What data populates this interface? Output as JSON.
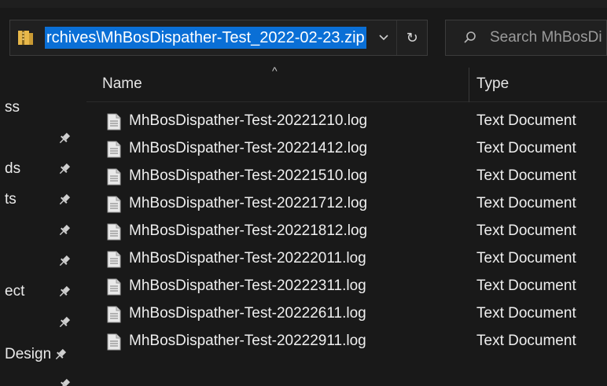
{
  "address": {
    "path": "rchives\\MhBosDispather-Test_2022-02-23.zip",
    "chevron_glyph": "⌄",
    "refresh_glyph": "↻"
  },
  "search": {
    "placeholder": "Search MhBosDi"
  },
  "nav": {
    "items": [
      {
        "label": "ss",
        "pinned": false
      },
      {
        "label": "",
        "pinned": true
      },
      {
        "label": "ds",
        "pinned": true
      },
      {
        "label": "ts",
        "pinned": true
      },
      {
        "label": "",
        "pinned": true
      },
      {
        "label": "",
        "pinned": true
      },
      {
        "label": "ect",
        "pinned": true
      },
      {
        "label": "",
        "pinned": true
      },
      {
        "label": "Design",
        "pinned": true
      },
      {
        "label": "",
        "pinned": true
      }
    ]
  },
  "columns": {
    "name": "Name",
    "type": "Type",
    "sort_glyph": "^"
  },
  "files": [
    {
      "name": "MhBosDispather-Test-20221210.log",
      "type": "Text Document"
    },
    {
      "name": "MhBosDispather-Test-20221412.log",
      "type": "Text Document"
    },
    {
      "name": "MhBosDispather-Test-20221510.log",
      "type": "Text Document"
    },
    {
      "name": "MhBosDispather-Test-20221712.log",
      "type": "Text Document"
    },
    {
      "name": "MhBosDispather-Test-20221812.log",
      "type": "Text Document"
    },
    {
      "name": "MhBosDispather-Test-20222011.log",
      "type": "Text Document"
    },
    {
      "name": "MhBosDispather-Test-20222311.log",
      "type": "Text Document"
    },
    {
      "name": "MhBosDispather-Test-20222611.log",
      "type": "Text Document"
    },
    {
      "name": "MhBosDispather-Test-20222911.log",
      "type": "Text Document"
    }
  ],
  "colors": {
    "background": "#191919",
    "selection": "#0a6fd6",
    "text": "#efefef",
    "folder_zip": "#e8b84a"
  }
}
